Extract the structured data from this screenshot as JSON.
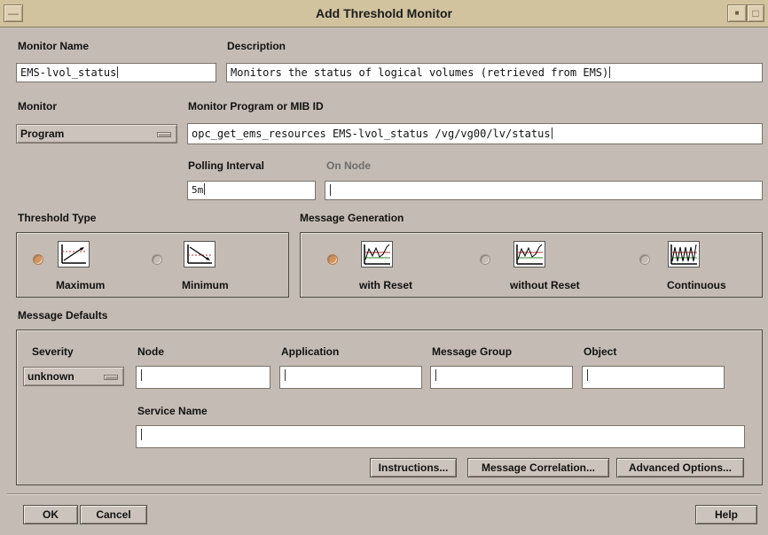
{
  "window": {
    "title": "Add Threshold Monitor"
  },
  "monitor_name": {
    "label": "Monitor Name",
    "value": "EMS-lvol_status"
  },
  "description": {
    "label": "Description",
    "value": "Monitors the status of logical volumes (retrieved from EMS)"
  },
  "monitor": {
    "label": "Monitor",
    "selected": "Program"
  },
  "monitor_program": {
    "label": "Monitor Program or MIB ID",
    "value": "opc_get_ems_resources EMS-lvol_status /vg/vg00/lv/status"
  },
  "polling_interval": {
    "label": "Polling Interval",
    "value": "5m"
  },
  "on_node": {
    "label": "On Node",
    "value": ""
  },
  "threshold_type": {
    "label": "Threshold Type",
    "options": [
      {
        "label": "Maximum",
        "selected": true
      },
      {
        "label": "Minimum",
        "selected": false
      }
    ]
  },
  "message_generation": {
    "label": "Message Generation",
    "options": [
      {
        "label": "with Reset",
        "selected": true
      },
      {
        "label": "without Reset",
        "selected": false
      },
      {
        "label": "Continuous",
        "selected": false
      }
    ]
  },
  "message_defaults": {
    "label": "Message Defaults",
    "severity": {
      "label": "Severity",
      "selected": "unknown"
    },
    "node": {
      "label": "Node",
      "value": ""
    },
    "application": {
      "label": "Application",
      "value": ""
    },
    "message_group": {
      "label": "Message Group",
      "value": ""
    },
    "object": {
      "label": "Object",
      "value": ""
    },
    "service_name": {
      "label": "Service Name",
      "value": ""
    },
    "buttons": {
      "instructions": "Instructions...",
      "message_correlation": "Message Correlation...",
      "advanced_options": "Advanced Options..."
    }
  },
  "footer": {
    "ok": "OK",
    "cancel": "Cancel",
    "help": "Help"
  },
  "colors": {
    "titlebar": "#d2c39f",
    "window": "#c4bcb4",
    "radio_selected": "#d6925a"
  }
}
